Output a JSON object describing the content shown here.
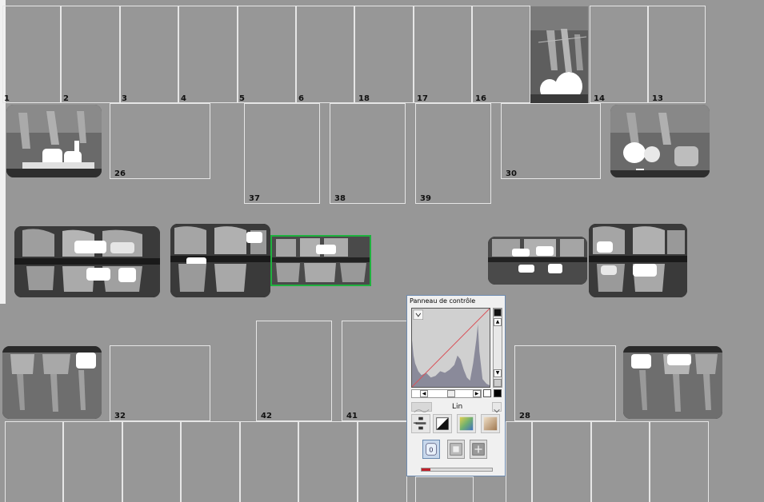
{
  "top_row_numbers": [
    "1",
    "2",
    "3",
    "4",
    "5",
    "6",
    "18",
    "17",
    "16",
    "14",
    "13"
  ],
  "second_row_numbers": [
    "26",
    "37",
    "38",
    "39",
    "30"
  ],
  "lower_row_numbers": [
    "32",
    "42",
    "41",
    "28"
  ],
  "control_panel": {
    "title": "Panneau de contrôle",
    "curve_mode": "Lin",
    "progress": 0.12
  },
  "colors": {
    "background": "#979797",
    "slot_border": "#e6e6e6",
    "selection": "#1fb13e",
    "progress": "#c0202a"
  }
}
